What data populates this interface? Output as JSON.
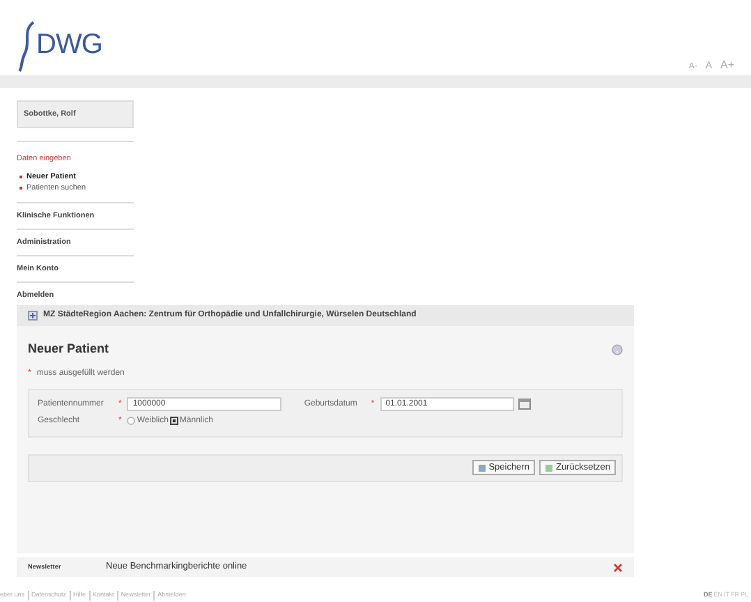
{
  "logo": {
    "text": "DWG"
  },
  "font_size_controls": [
    "A-",
    "A",
    "A+"
  ],
  "sidebar": {
    "user": "Sobottke, Rolf",
    "section": {
      "title": "Daten eingeben",
      "items": [
        {
          "label": "Neuer Patient",
          "selected": true
        },
        {
          "label": "Patienten suchen",
          "selected": false
        }
      ]
    },
    "menu": [
      "Klinische Funktionen",
      "Administration",
      "Mein Konto",
      "Abmelden"
    ]
  },
  "panel": {
    "header": "MZ StädteRegion Aachen: Zentrum für Orthopädie und Unfallchirurgie, Würselen Deutschland",
    "title": "Neuer Patient",
    "required_note": {
      "mark": "*",
      "text": "muss ausgefüllt werden"
    },
    "patient_number": {
      "label": "Patientennummer",
      "required_mark": "*",
      "value": "1000000"
    },
    "birth_date": {
      "label": "Geburtsdatum",
      "required_mark": "*",
      "value": "01.01.2001"
    },
    "gender": {
      "label": "Geschlecht",
      "required_mark": "*",
      "options": [
        {
          "label": "Weiblich",
          "selected": false
        },
        {
          "label": "Männlich",
          "selected": true
        }
      ]
    },
    "buttons": [
      "Speichern",
      "Zurücksetzen"
    ]
  },
  "newsletter": {
    "label": "Newsletter",
    "text": "Neue Benchmarkingberichte online"
  },
  "footer": {
    "links": [
      "eber uns",
      "Datenschutz",
      "Hilfe",
      "Kontakt",
      "Newsletter",
      "Abmelden"
    ],
    "languages": [
      {
        "label": "DE",
        "selected": true
      },
      {
        "label": "EN",
        "selected": false
      },
      {
        "label": "IT",
        "selected": false
      },
      {
        "label": "FR",
        "selected": false
      },
      {
        "label": "PL",
        "selected": false
      }
    ]
  }
}
